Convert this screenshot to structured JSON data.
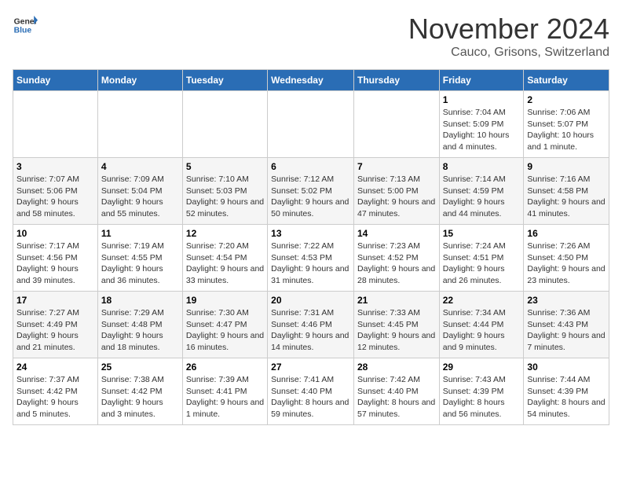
{
  "logo": {
    "general": "General",
    "blue": "Blue"
  },
  "title": "November 2024",
  "location": "Cauco, Grisons, Switzerland",
  "days_of_week": [
    "Sunday",
    "Monday",
    "Tuesday",
    "Wednesday",
    "Thursday",
    "Friday",
    "Saturday"
  ],
  "weeks": [
    [
      {
        "day": "",
        "detail": ""
      },
      {
        "day": "",
        "detail": ""
      },
      {
        "day": "",
        "detail": ""
      },
      {
        "day": "",
        "detail": ""
      },
      {
        "day": "",
        "detail": ""
      },
      {
        "day": "1",
        "detail": "Sunrise: 7:04 AM\nSunset: 5:09 PM\nDaylight: 10 hours and 4 minutes."
      },
      {
        "day": "2",
        "detail": "Sunrise: 7:06 AM\nSunset: 5:07 PM\nDaylight: 10 hours and 1 minute."
      }
    ],
    [
      {
        "day": "3",
        "detail": "Sunrise: 7:07 AM\nSunset: 5:06 PM\nDaylight: 9 hours and 58 minutes."
      },
      {
        "day": "4",
        "detail": "Sunrise: 7:09 AM\nSunset: 5:04 PM\nDaylight: 9 hours and 55 minutes."
      },
      {
        "day": "5",
        "detail": "Sunrise: 7:10 AM\nSunset: 5:03 PM\nDaylight: 9 hours and 52 minutes."
      },
      {
        "day": "6",
        "detail": "Sunrise: 7:12 AM\nSunset: 5:02 PM\nDaylight: 9 hours and 50 minutes."
      },
      {
        "day": "7",
        "detail": "Sunrise: 7:13 AM\nSunset: 5:00 PM\nDaylight: 9 hours and 47 minutes."
      },
      {
        "day": "8",
        "detail": "Sunrise: 7:14 AM\nSunset: 4:59 PM\nDaylight: 9 hours and 44 minutes."
      },
      {
        "day": "9",
        "detail": "Sunrise: 7:16 AM\nSunset: 4:58 PM\nDaylight: 9 hours and 41 minutes."
      }
    ],
    [
      {
        "day": "10",
        "detail": "Sunrise: 7:17 AM\nSunset: 4:56 PM\nDaylight: 9 hours and 39 minutes."
      },
      {
        "day": "11",
        "detail": "Sunrise: 7:19 AM\nSunset: 4:55 PM\nDaylight: 9 hours and 36 minutes."
      },
      {
        "day": "12",
        "detail": "Sunrise: 7:20 AM\nSunset: 4:54 PM\nDaylight: 9 hours and 33 minutes."
      },
      {
        "day": "13",
        "detail": "Sunrise: 7:22 AM\nSunset: 4:53 PM\nDaylight: 9 hours and 31 minutes."
      },
      {
        "day": "14",
        "detail": "Sunrise: 7:23 AM\nSunset: 4:52 PM\nDaylight: 9 hours and 28 minutes."
      },
      {
        "day": "15",
        "detail": "Sunrise: 7:24 AM\nSunset: 4:51 PM\nDaylight: 9 hours and 26 minutes."
      },
      {
        "day": "16",
        "detail": "Sunrise: 7:26 AM\nSunset: 4:50 PM\nDaylight: 9 hours and 23 minutes."
      }
    ],
    [
      {
        "day": "17",
        "detail": "Sunrise: 7:27 AM\nSunset: 4:49 PM\nDaylight: 9 hours and 21 minutes."
      },
      {
        "day": "18",
        "detail": "Sunrise: 7:29 AM\nSunset: 4:48 PM\nDaylight: 9 hours and 18 minutes."
      },
      {
        "day": "19",
        "detail": "Sunrise: 7:30 AM\nSunset: 4:47 PM\nDaylight: 9 hours and 16 minutes."
      },
      {
        "day": "20",
        "detail": "Sunrise: 7:31 AM\nSunset: 4:46 PM\nDaylight: 9 hours and 14 minutes."
      },
      {
        "day": "21",
        "detail": "Sunrise: 7:33 AM\nSunset: 4:45 PM\nDaylight: 9 hours and 12 minutes."
      },
      {
        "day": "22",
        "detail": "Sunrise: 7:34 AM\nSunset: 4:44 PM\nDaylight: 9 hours and 9 minutes."
      },
      {
        "day": "23",
        "detail": "Sunrise: 7:36 AM\nSunset: 4:43 PM\nDaylight: 9 hours and 7 minutes."
      }
    ],
    [
      {
        "day": "24",
        "detail": "Sunrise: 7:37 AM\nSunset: 4:42 PM\nDaylight: 9 hours and 5 minutes."
      },
      {
        "day": "25",
        "detail": "Sunrise: 7:38 AM\nSunset: 4:42 PM\nDaylight: 9 hours and 3 minutes."
      },
      {
        "day": "26",
        "detail": "Sunrise: 7:39 AM\nSunset: 4:41 PM\nDaylight: 9 hours and 1 minute."
      },
      {
        "day": "27",
        "detail": "Sunrise: 7:41 AM\nSunset: 4:40 PM\nDaylight: 8 hours and 59 minutes."
      },
      {
        "day": "28",
        "detail": "Sunrise: 7:42 AM\nSunset: 4:40 PM\nDaylight: 8 hours and 57 minutes."
      },
      {
        "day": "29",
        "detail": "Sunrise: 7:43 AM\nSunset: 4:39 PM\nDaylight: 8 hours and 56 minutes."
      },
      {
        "day": "30",
        "detail": "Sunrise: 7:44 AM\nSunset: 4:39 PM\nDaylight: 8 hours and 54 minutes."
      }
    ]
  ]
}
